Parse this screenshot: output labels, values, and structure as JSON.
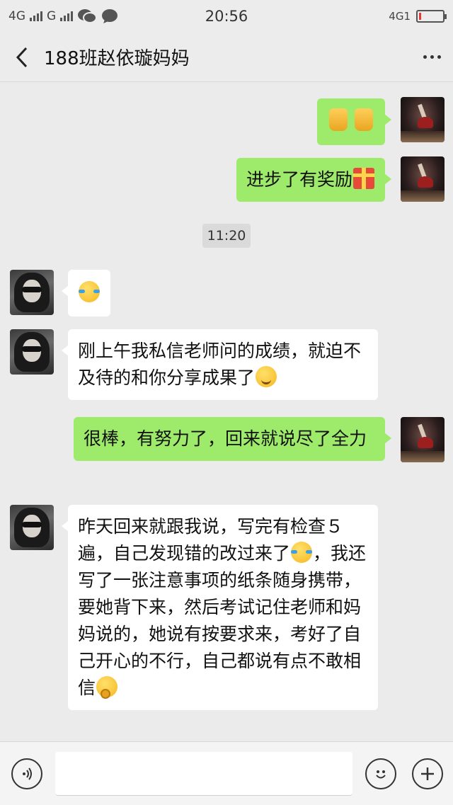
{
  "status_bar": {
    "signal_1": "4G",
    "signal_2": "G",
    "time": "20:56",
    "network_right": "4G1",
    "battery_level": 0.1
  },
  "nav": {
    "title": "188班赵依璇妈妈",
    "back_icon": "chevron-left-icon",
    "more_icon": "more-dots-icon"
  },
  "messages": [
    {
      "side": "out",
      "text": "",
      "emoji": [
        "thumbs-up",
        "thumbs-up"
      ]
    },
    {
      "side": "out",
      "text": "进步了有奖励",
      "emoji": [
        "gift"
      ]
    },
    {
      "side": "time",
      "text": "11:20"
    },
    {
      "side": "in",
      "text": "",
      "emoji": [
        "tears-of-joy"
      ]
    },
    {
      "side": "in",
      "text": "刚上午我私信老师问的成绩，就迫不及待的和你分享成果了",
      "emoji": [
        "grin"
      ]
    },
    {
      "side": "out",
      "text": "很棒，有努力了，回来就说尽了全力",
      "emoji": []
    },
    {
      "side": "in",
      "text_before_emoji": "昨天回来就跟我说，写完有检查５遍，自己发现错的改过来了",
      "text_after_emoji": "，我还写了一张注意事项的纸条随身携带，要她背下来，然后考试记住老师和妈妈说的，她说有按要求来，考好了自己开心的不行，自己都说有点不敢相信",
      "emoji": [
        "tears-of-joy",
        "thinking"
      ]
    }
  ],
  "input_bar": {
    "voice_icon": "voice-icon",
    "emoji_icon": "smiley-icon",
    "plus_icon": "plus-icon",
    "input_value": "",
    "input_placeholder": ""
  },
  "colors": {
    "outgoing_bubble": "#9eea6a",
    "incoming_bubble": "#ffffff",
    "background": "#ebebeb"
  }
}
